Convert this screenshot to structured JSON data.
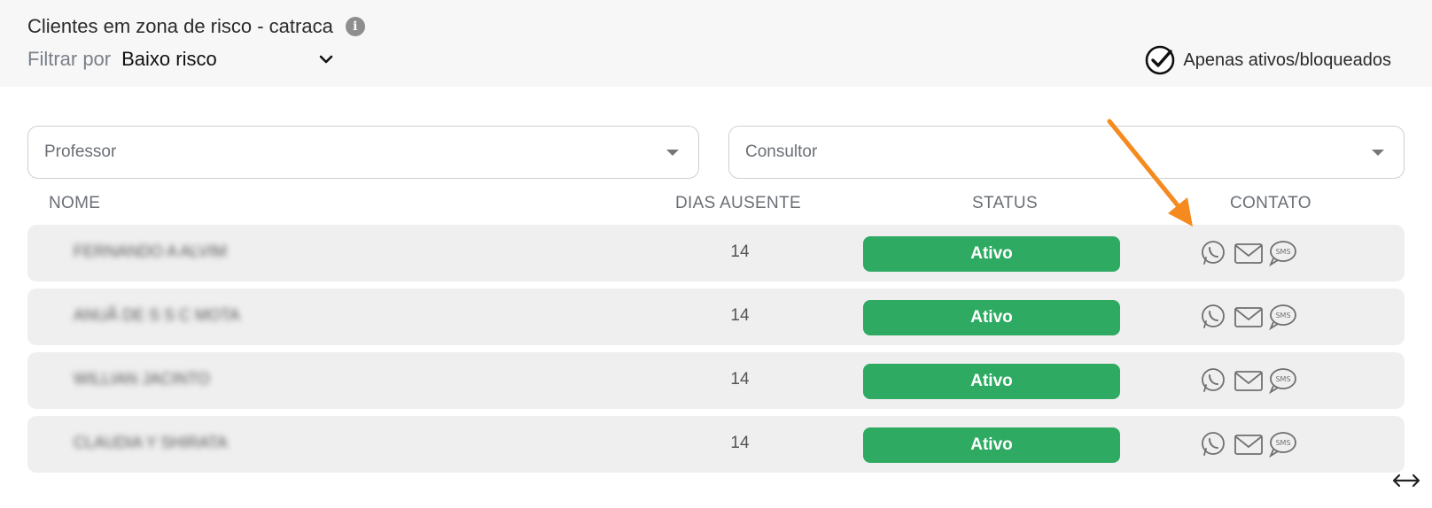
{
  "header": {
    "title": "Clientes em zona de risco - catraca",
    "info_icon": "info-icon",
    "filter_label": "Filtrar por",
    "filter_value": "Baixo risco",
    "only_active_label": "Apenas ativos/bloqueados",
    "only_active_checked": true
  },
  "filters": {
    "professor_placeholder": "Professor",
    "consultor_placeholder": "Consultor"
  },
  "table": {
    "columns": [
      "NOME",
      "DIAS AUSENTE",
      "STATUS",
      "CONTATO"
    ],
    "rows": [
      {
        "name": "FERNANDO A ALVIM",
        "days": "14",
        "status": "Ativo"
      },
      {
        "name": "ANUÃ DE S S C MOTA",
        "days": "14",
        "status": "Ativo"
      },
      {
        "name": "WILLIAN JACINTO",
        "days": "14",
        "status": "Ativo"
      },
      {
        "name": "CLAUDIA Y SHIRATA",
        "days": "14",
        "status": "Ativo"
      }
    ],
    "contact_icons": [
      "whatsapp-icon",
      "email-icon",
      "sms-icon"
    ]
  },
  "colors": {
    "status_active": "#2faa63",
    "annotation_arrow": "#f58a1f",
    "header_bg": "#f7f7f7",
    "row_bg": "#efefef"
  }
}
